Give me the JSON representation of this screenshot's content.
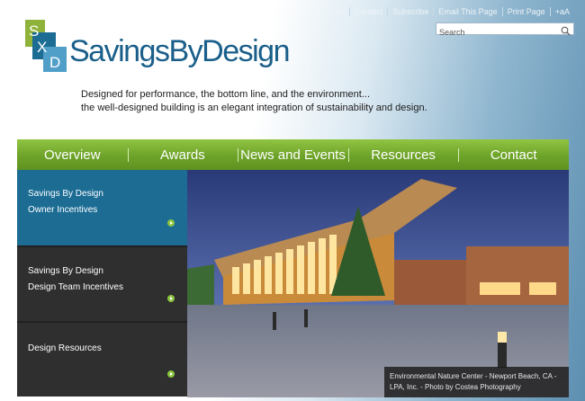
{
  "header": {
    "top_links": [
      "Home",
      "Contact",
      "Subscribe",
      "Email This Page",
      "Print Page",
      "+aA"
    ],
    "search": {
      "placeholder": "Search"
    },
    "logo": {
      "mark_letters": [
        "S",
        "X",
        "D"
      ],
      "text": "SavingsByDesign"
    },
    "tagline": {
      "line1": "Designed for performance, the bottom line, and the environment...",
      "line2": "the well-designed building is an elegant integration of sustainability and design."
    }
  },
  "nav": {
    "items": [
      "Overview",
      "Awards",
      "News and Events",
      "Resources",
      "Contact"
    ]
  },
  "sidebar": {
    "buttons": [
      {
        "line1": "Savings By Design",
        "line2": "Owner Incentives"
      },
      {
        "line1": "Savings By Design",
        "line2": "Design Team Incentives"
      },
      {
        "line1": "Design Resources",
        "line2": ""
      }
    ]
  },
  "hero": {
    "caption_line1": "Environmental Nature Center - Newport Beach, CA -",
    "caption_line2": "LPA, Inc. - Photo by Costea Photography"
  },
  "colors": {
    "nav_green": "#7ab433",
    "sidebar_active": "#1c6c94",
    "sidebar_dark": "#2f2f2f",
    "arrow_green": "#8cc63f",
    "logo_blue": "#1a5f8a"
  },
  "icons": {
    "search": "search-icon",
    "arrow": "arrow-right-circle-icon"
  }
}
